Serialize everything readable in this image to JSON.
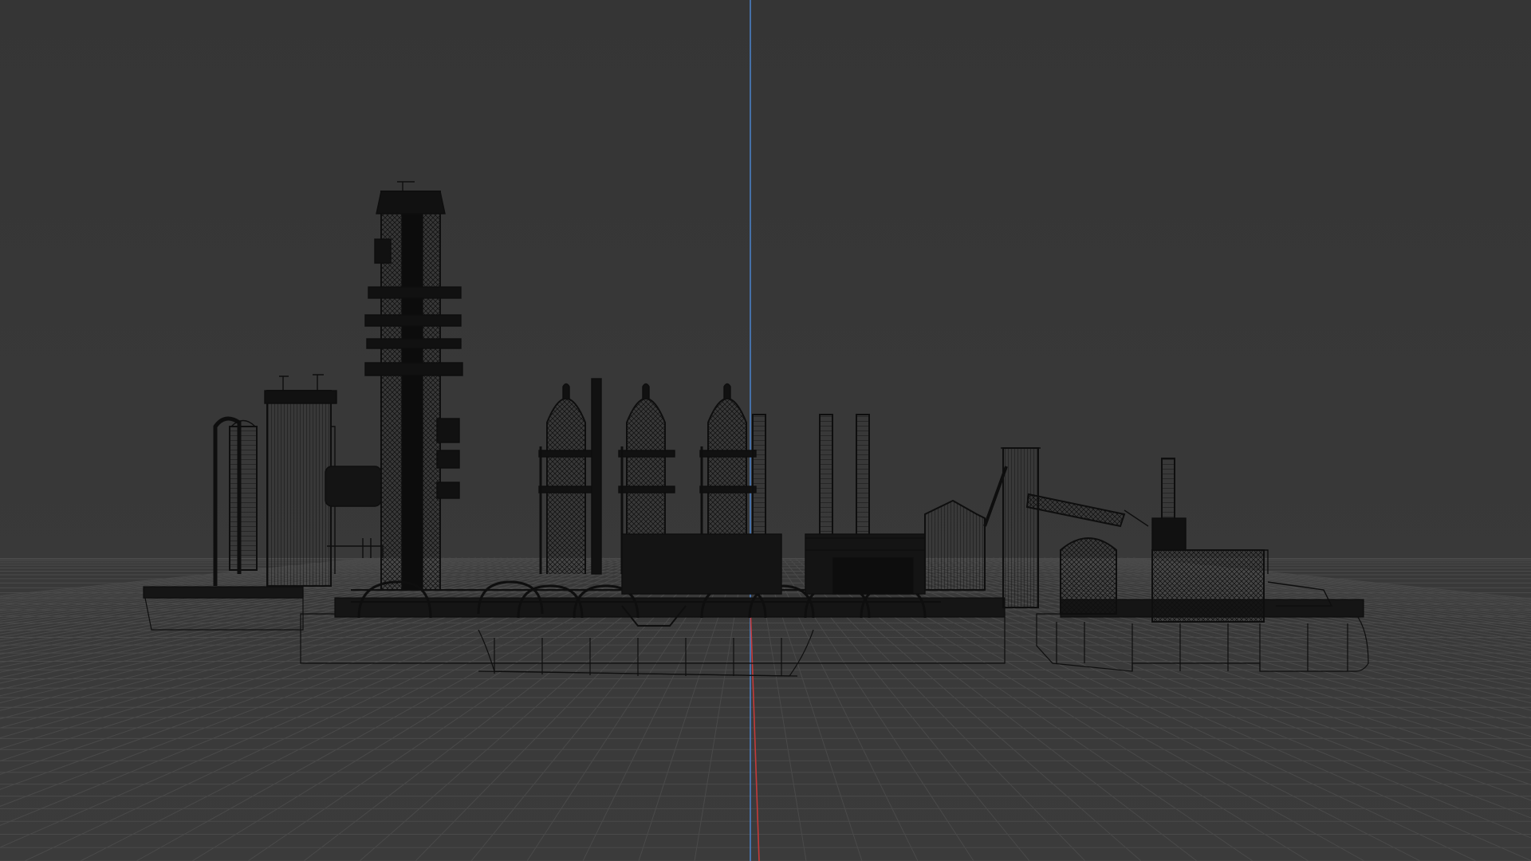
{
  "viewport": {
    "mode": "wireframe",
    "background_color": "#3a3a3a",
    "background_color_top": "#353535",
    "grid_color": "#4a4a4a",
    "wire_color": "#0e0e0e",
    "axis_y_color": "#4a7fc4",
    "axis_x_color": "#c43a3a",
    "grid_visible": true,
    "object": "industrial-refinery-wireframe"
  }
}
